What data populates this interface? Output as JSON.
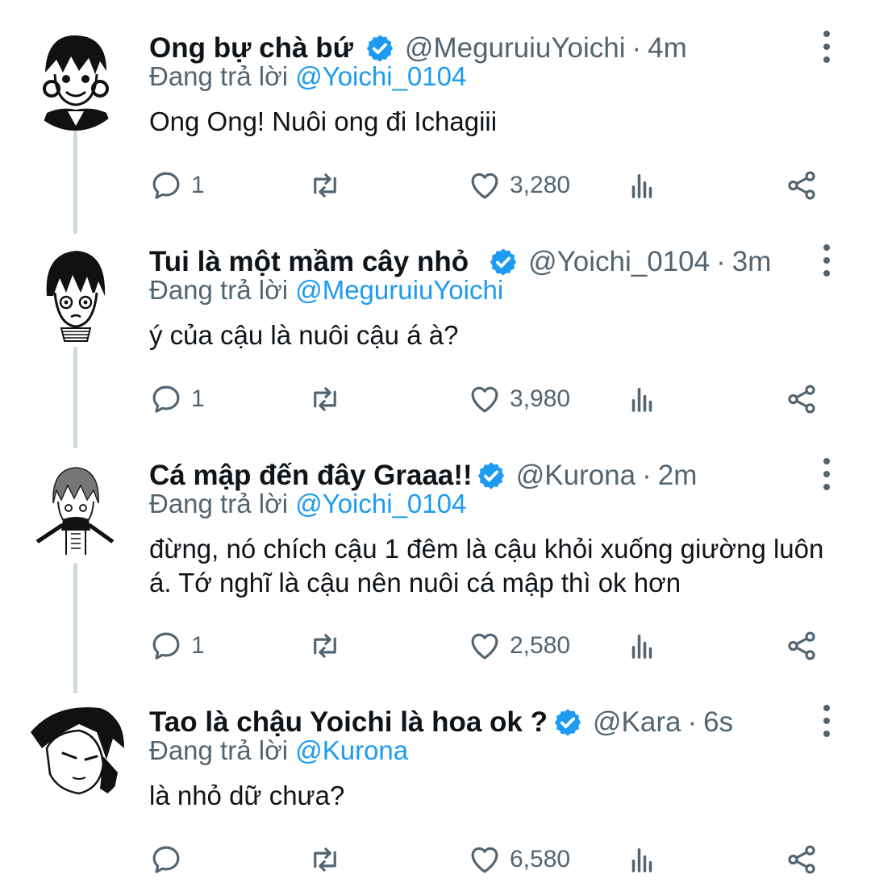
{
  "tweets": [
    {
      "name": "Ong bự chà bứ",
      "handle": "@MeguruiuYoichi",
      "time": "4m",
      "replying_prefix": "Đang trả lời",
      "replying_to": "@Yoichi_0104",
      "text": "Ong Ong! Nuôi ong đi Ichagiii",
      "replies": "1",
      "likes": "3,280"
    },
    {
      "name": "Tui là một mầm cây nhỏ",
      "handle": "@Yoichi_0104",
      "time": "3m",
      "replying_prefix": "Đang trả lời",
      "replying_to": "@MeguruiuYoichi",
      "text": "ý của cậu là nuôi cậu á à?",
      "replies": "1",
      "likes": "3,980"
    },
    {
      "name": "Cá mập đến đây Graaa!!",
      "handle": "@Kurona",
      "time": "2m",
      "replying_prefix": "Đang trả lời",
      "replying_to": "@Yoichi_0104",
      "text": "đừng, nó chích cậu 1 đêm là cậu khỏi xuống giường luôn á. Tớ nghĩ là cậu nên nuôi cá mập thì ok hơn",
      "replies": "1",
      "likes": "2,580"
    },
    {
      "name": "Tao là chậu Yoichi là hoa ok ?",
      "handle": "@Kara",
      "time": "6s",
      "replying_prefix": "Đang trả lời",
      "replying_to": "@Kurona",
      "text": "là nhỏ dữ chưa?",
      "replies": "",
      "likes": "6,580"
    }
  ],
  "separator": "·",
  "colors": {
    "accent": "#1d9bf0",
    "muted": "#536471",
    "text": "#0f1419",
    "thread_line": "#cfd9de"
  },
  "icons": [
    "verified-badge-icon",
    "more-vertical-icon",
    "reply-icon",
    "retweet-icon",
    "like-icon",
    "views-icon",
    "share-icon"
  ]
}
